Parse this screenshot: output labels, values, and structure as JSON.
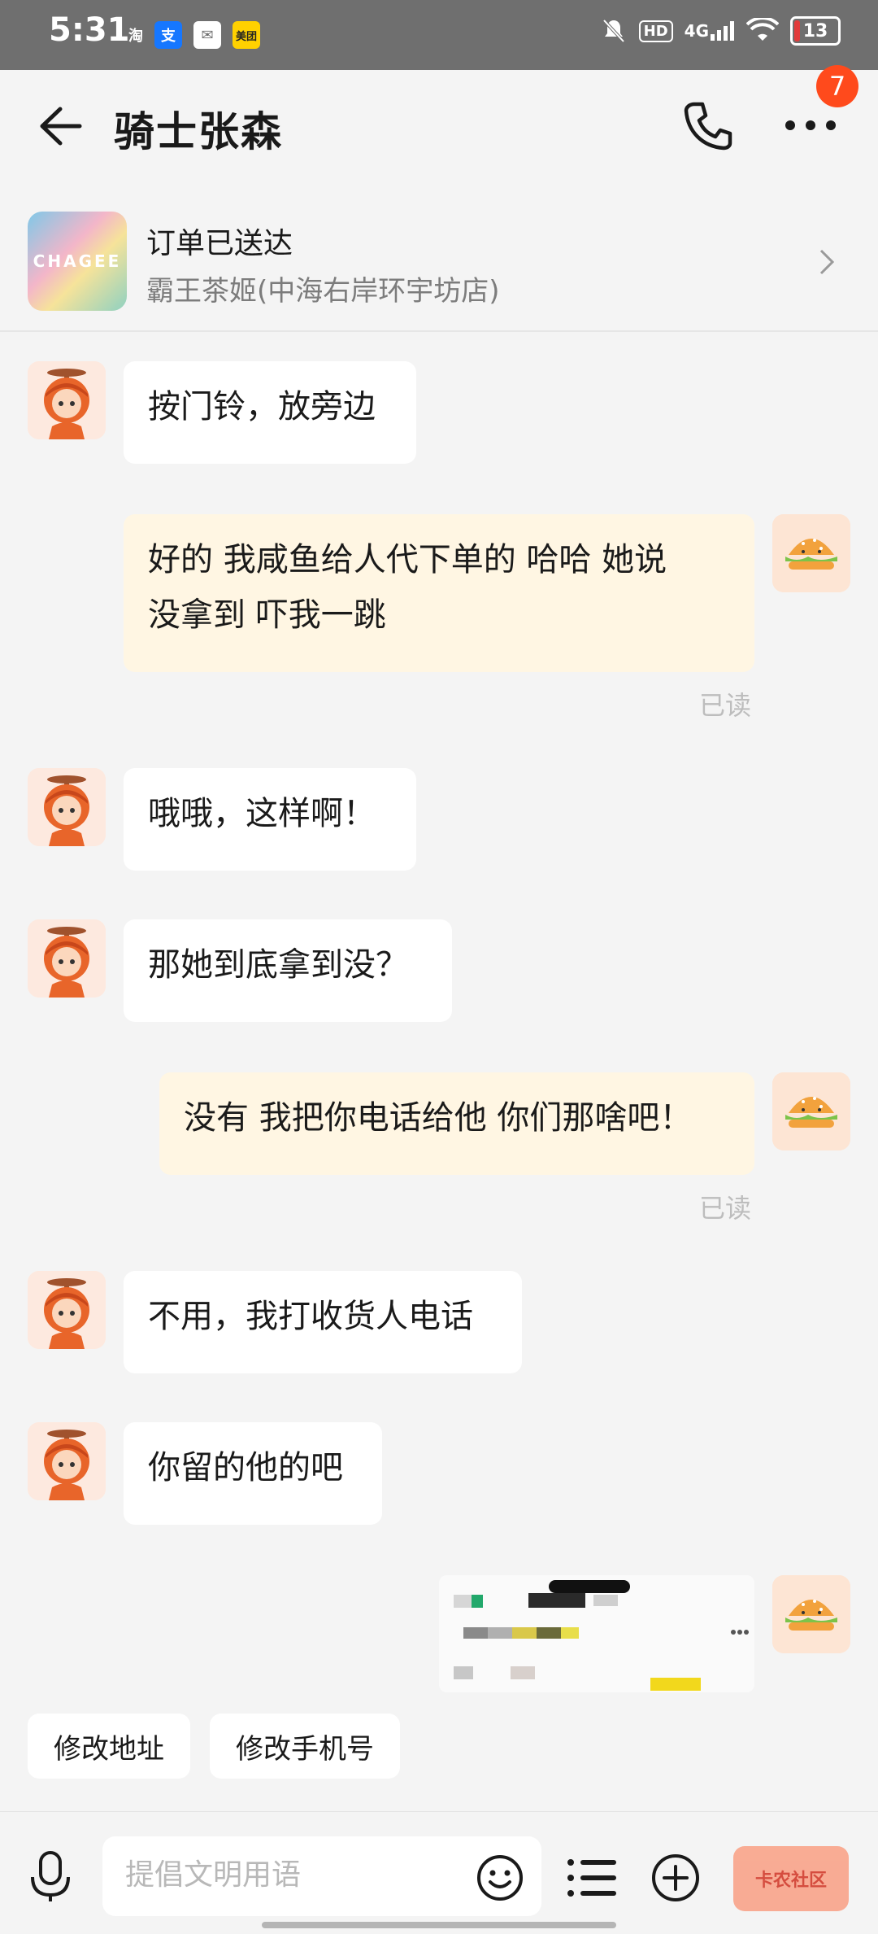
{
  "status_bar": {
    "time": "5:31",
    "apps": [
      "淘",
      "支",
      "✉",
      "美团"
    ],
    "hd": "HD",
    "network": "4G",
    "battery": "13"
  },
  "header": {
    "title": "骑士张森",
    "notification_count": "7"
  },
  "order": {
    "logo_text": "CHAGEE",
    "status": "订单已送达",
    "store": "霸王茶姬(中海右岸环宇坊店)"
  },
  "messages": [
    {
      "side": "left",
      "text": "按门铃，放旁边"
    },
    {
      "side": "right",
      "lines": [
        "好的 我咸鱼给人代下单的 哈哈 她说",
        "没拿到 吓我一跳"
      ],
      "read": "已读"
    },
    {
      "side": "left",
      "text": "哦哦，这样啊！"
    },
    {
      "side": "left",
      "text": "那她到底拿到没？"
    },
    {
      "side": "right",
      "text": "没有 我把你电话给他 你们那啥吧！",
      "read": "已读"
    },
    {
      "side": "left",
      "text": "不用，我打收货人电话"
    },
    {
      "side": "left",
      "text": "你留的他的吧"
    },
    {
      "side": "right",
      "type": "image"
    }
  ],
  "quick_actions": [
    "修改地址",
    "修改手机号"
  ],
  "input": {
    "placeholder": "提倡文明用语"
  },
  "watermark": "卡农社区",
  "colors": {
    "accent_badge": "#ff4a1c",
    "right_bubble": "#fff6e3",
    "left_bubble": "#ffffff",
    "background": "#f4f4f4"
  }
}
